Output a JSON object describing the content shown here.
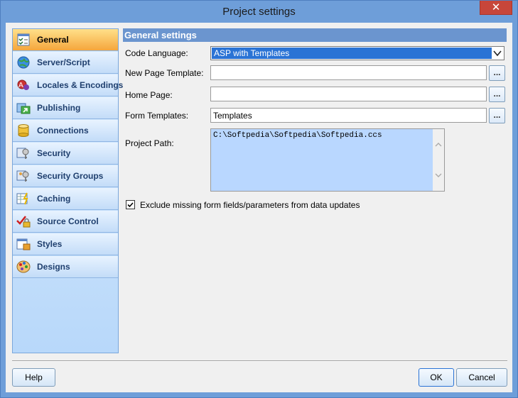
{
  "window": {
    "title": "Project settings",
    "close_glyph": "✕"
  },
  "sidebar": {
    "items": [
      {
        "label": "General",
        "icon": "checklist-icon",
        "active": true
      },
      {
        "label": "Server/Script",
        "icon": "globe-icon"
      },
      {
        "label": "Locales & Encodings",
        "icon": "locale-icon"
      },
      {
        "label": "Publishing",
        "icon": "publish-icon"
      },
      {
        "label": "Connections",
        "icon": "database-icon"
      },
      {
        "label": "Security",
        "icon": "key-icon"
      },
      {
        "label": "Security Groups",
        "icon": "key-group-icon"
      },
      {
        "label": "Caching",
        "icon": "cache-icon"
      },
      {
        "label": "Source Control",
        "icon": "lock-check-icon"
      },
      {
        "label": "Styles",
        "icon": "styles-icon"
      },
      {
        "label": "Designs",
        "icon": "palette-icon"
      }
    ]
  },
  "general": {
    "header": "General settings",
    "code_language_label": "Code Language:",
    "code_language_value": "ASP with Templates",
    "new_page_template_label": "New Page Template:",
    "new_page_template_value": "",
    "home_page_label": "Home Page:",
    "home_page_value": "",
    "form_templates_label": "Form Templates:",
    "form_templates_value": "Templates",
    "project_path_label": "Project Path:",
    "project_path_value": "C:\\Softpedia\\Softpedia\\Softpedia.ccs",
    "browse_label": "...",
    "exclude_label": "Exclude missing form fields/parameters from data updates",
    "exclude_checked": true
  },
  "buttons": {
    "help": "Help",
    "ok": "OK",
    "cancel": "Cancel"
  },
  "colors": {
    "accent": "#2a73d5",
    "header": "#6b95cf",
    "active_nav": "#f5a63c"
  }
}
